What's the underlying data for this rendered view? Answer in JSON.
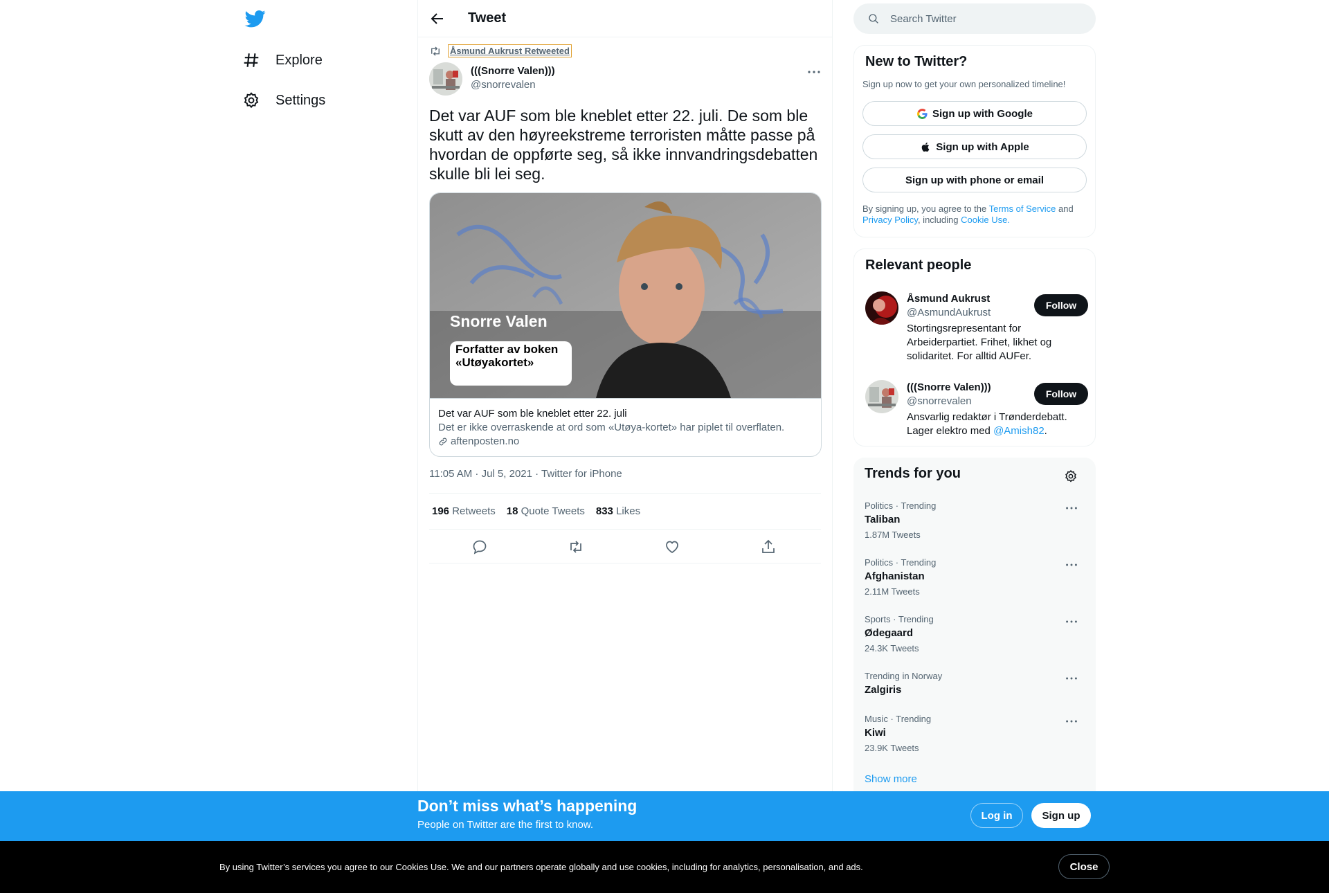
{
  "nav": {
    "items": [
      {
        "label": "Explore"
      },
      {
        "label": "Settings"
      }
    ]
  },
  "header": {
    "title": "Tweet"
  },
  "tweet": {
    "retweeted_by": "Åsmund Aukrust Retweeted",
    "author_name": "(((Snorre Valen)))",
    "author_handle": "@snorrevalen",
    "text": "Det var AUF som ble kneblet etter 22. juli. De som ble skutt av den høyreekstreme terroristen måtte passe på hvordan de oppførte seg, så ikke innvandringsdebatten skulle bli lei seg.",
    "card": {
      "image_name": "Snorre Valen",
      "image_box": "Forfatter av boken «Utøyakortet»",
      "title": "Det var AUF som ble kneblet etter 22. juli",
      "description": "Det er ikke overraskende at ord som «Utøya-kortet» har piplet til overflaten.",
      "domain": "aftenposten.no"
    },
    "timestamp": "11:05 AM · Jul 5, 2021 · Twitter for iPhone",
    "stats": [
      {
        "count": "196",
        "label": "Retweets"
      },
      {
        "count": "18",
        "label": "Quote Tweets"
      },
      {
        "count": "833",
        "label": "Likes"
      }
    ]
  },
  "search": {
    "placeholder": "Search Twitter"
  },
  "new_to_twitter": {
    "title": "New to Twitter?",
    "subtitle": "Sign up now to get your own personalized timeline!",
    "google": "Sign up with Google",
    "apple": "Sign up with Apple",
    "phone": "Sign up with phone or email",
    "legal_1": "By signing up, you agree to the ",
    "terms": "Terms of Service",
    "legal_2": " and ",
    "privacy": "Privacy Policy",
    "legal_3": ", including ",
    "cookie": "Cookie Use."
  },
  "relevant_people": {
    "title": "Relevant people",
    "people": [
      {
        "name": "Åsmund Aukrust",
        "handle": "@AsmundAukrust",
        "bio": "Stortingsrepresentant for Arbeiderpartiet. Frihet, likhet og solidaritet. For alltid AUFer.",
        "follow": "Follow"
      },
      {
        "name": "(((Snorre Valen)))",
        "handle": "@snorrevalen",
        "bio_prefix": "Ansvarlig redaktør i Trønderdebatt. Lager elektro med ",
        "bio_link": "@Amish82",
        "bio_suffix": ".",
        "follow": "Follow"
      }
    ]
  },
  "trends": {
    "title": "Trends for you",
    "items": [
      {
        "context": "Politics · Trending",
        "name": "Taliban",
        "count": "1.87M Tweets"
      },
      {
        "context": "Politics · Trending",
        "name": "Afghanistan",
        "count": "2.11M Tweets"
      },
      {
        "context": "Sports · Trending",
        "name": "Ødegaard",
        "count": "24.3K Tweets"
      },
      {
        "context": "Trending in Norway",
        "name": "Zalgiris",
        "count": ""
      },
      {
        "context": "Music · Trending",
        "name": "Kiwi",
        "count": "23.9K Tweets"
      }
    ],
    "show_more": "Show more"
  },
  "promo": {
    "title": "Don’t miss what’s happening",
    "subtitle": "People on Twitter are the first to know.",
    "login": "Log in",
    "signup": "Sign up"
  },
  "cookie_bar": {
    "text": "By using Twitter’s services you agree to our Cookies Use. We and our partners operate globally and use cookies, including for analytics, personalisation, and ads.",
    "close": "Close"
  },
  "colors": {
    "brand_blue": "#1d9bf0",
    "text_primary": "#0f1419",
    "text_secondary": "#536471",
    "border": "#eff3f4"
  },
  "icons": [
    "twitter-logo-icon",
    "hashtag-icon",
    "gear-icon",
    "back-arrow-icon",
    "retweet-icon",
    "more-icon",
    "link-icon",
    "reply-icon",
    "like-icon",
    "share-icon",
    "search-icon",
    "google-icon",
    "apple-icon"
  ]
}
